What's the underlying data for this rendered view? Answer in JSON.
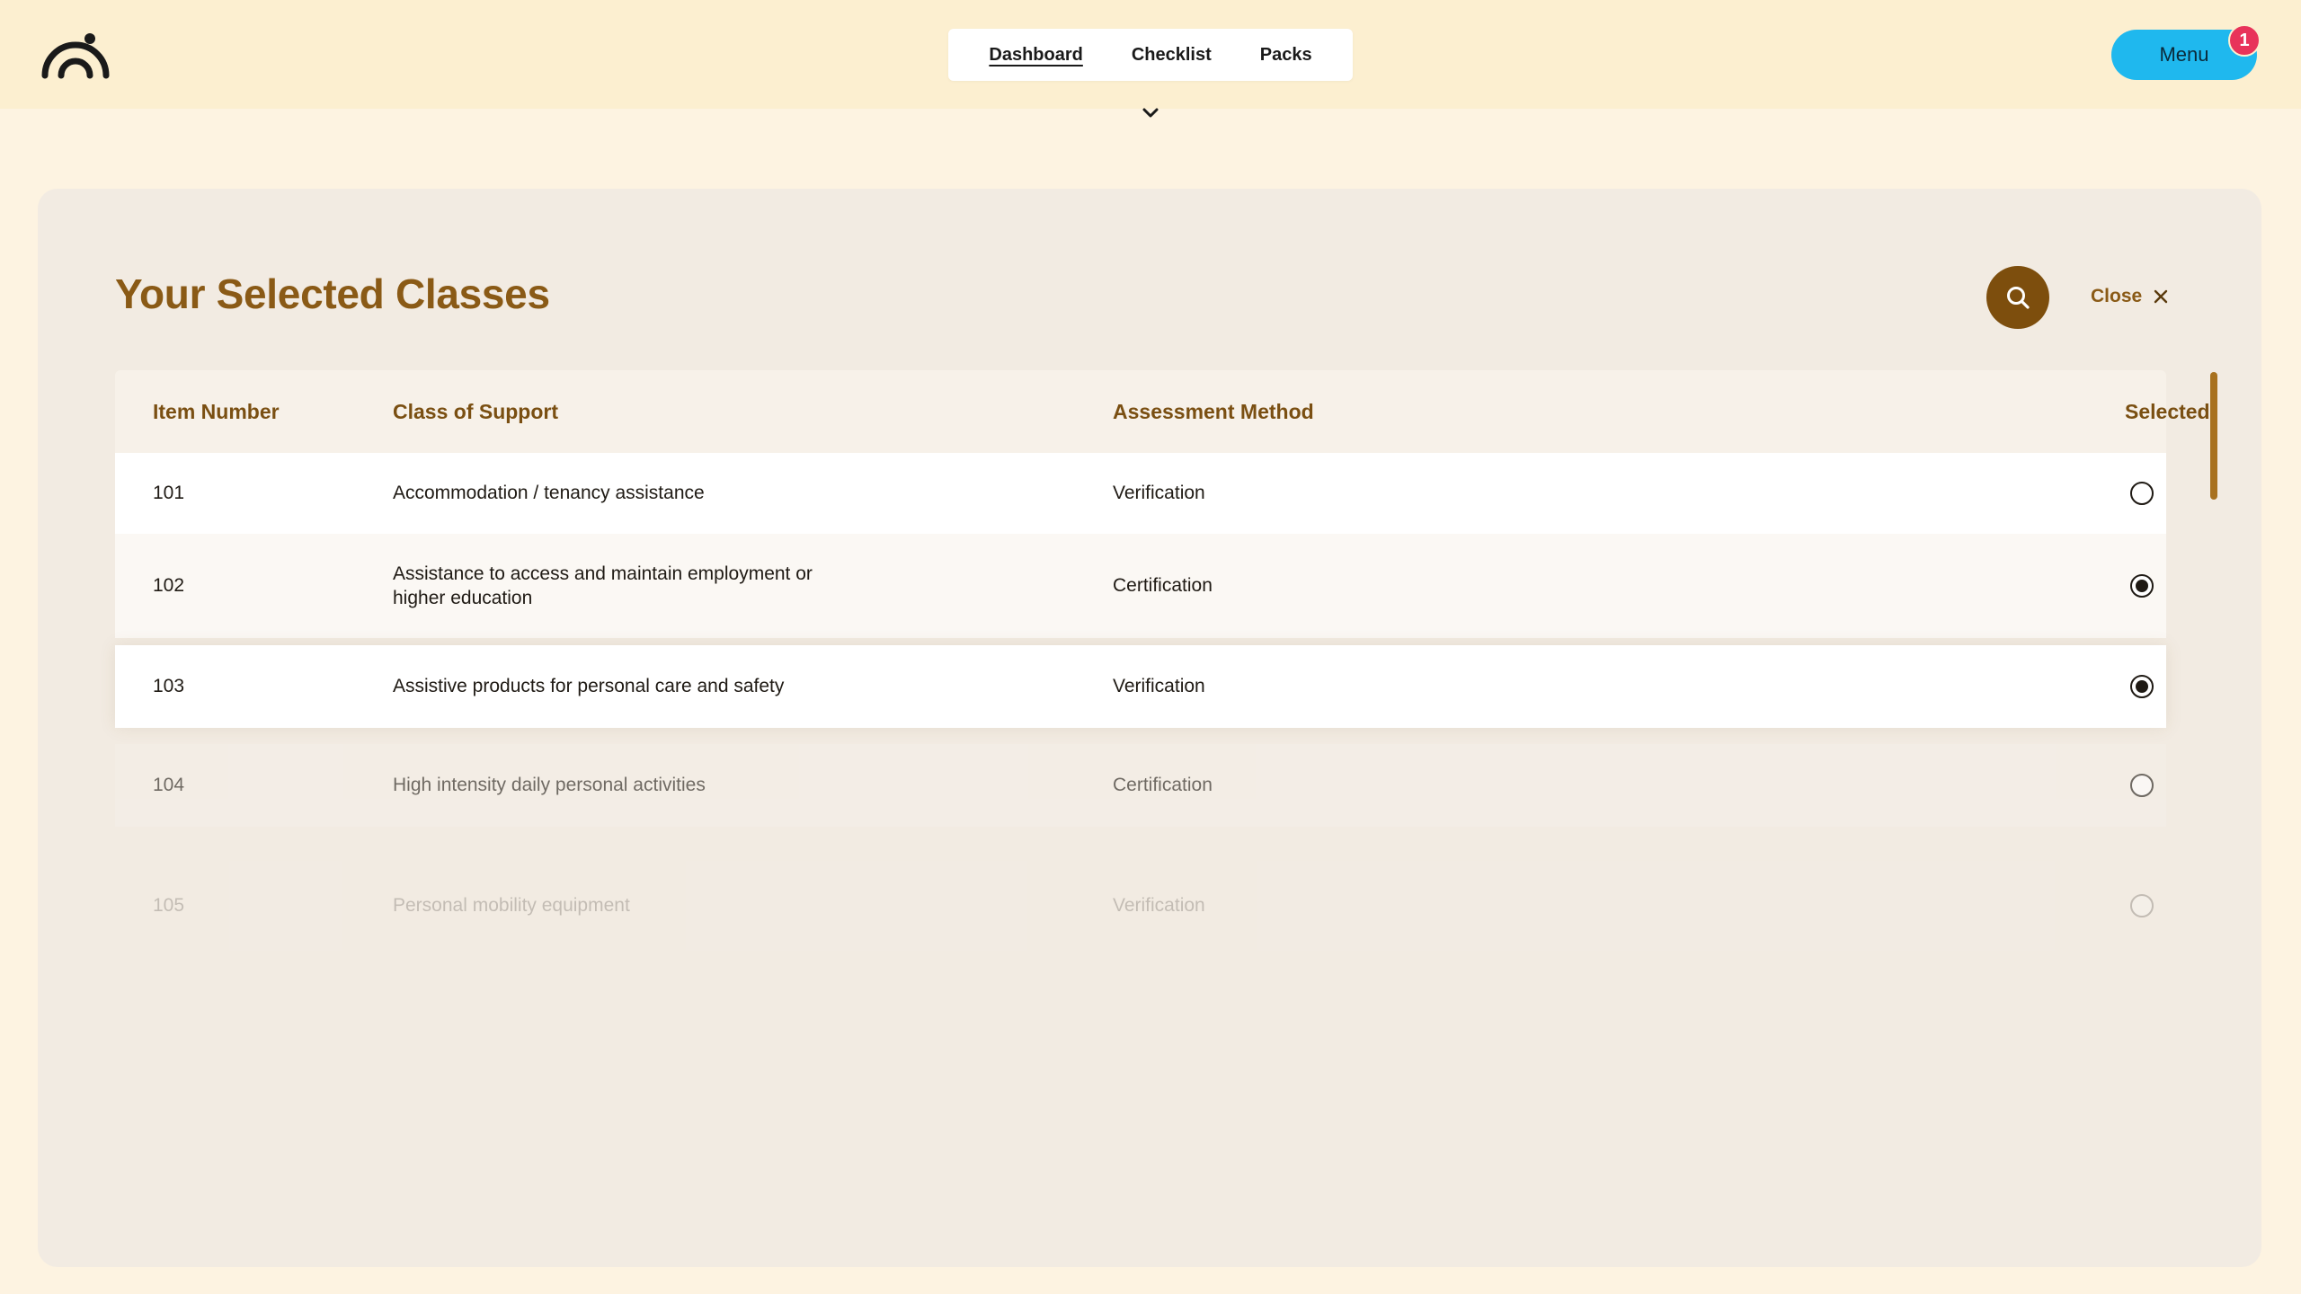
{
  "nav": {
    "tabs": [
      {
        "label": "Dashboard",
        "active": true
      },
      {
        "label": "Checklist",
        "active": false
      },
      {
        "label": "Packs",
        "active": false
      }
    ],
    "menu_label": "Menu",
    "menu_badge": "1"
  },
  "panel": {
    "title": "Your Selected Classes",
    "close_label": "Close"
  },
  "table": {
    "headers": [
      "Item Number",
      "Class of Support",
      "Assessment Method",
      "Selected"
    ],
    "rows": [
      {
        "item": "101",
        "class": "Accommodation / tenancy assistance",
        "method": "Verification",
        "selected": false
      },
      {
        "item": "102",
        "class": "Assistance to access and maintain employment or higher education",
        "method": "Certification",
        "selected": true
      },
      {
        "item": "103",
        "class": "Assistive products for personal care and safety",
        "method": "Verification",
        "selected": true
      },
      {
        "item": "104",
        "class": "High intensity daily personal activities",
        "method": "Certification",
        "selected": false
      },
      {
        "item": "105",
        "class": "Personal mobility equipment",
        "method": "Verification",
        "selected": false
      }
    ]
  },
  "colors": {
    "accent_brown": "#8a5a16",
    "search_button": "#7d4e0d",
    "menu_button": "#1fb8ee",
    "badge": "#e8335a"
  },
  "icons": [
    "logo-icon",
    "chevron-down-icon",
    "search-icon",
    "close-icon"
  ]
}
